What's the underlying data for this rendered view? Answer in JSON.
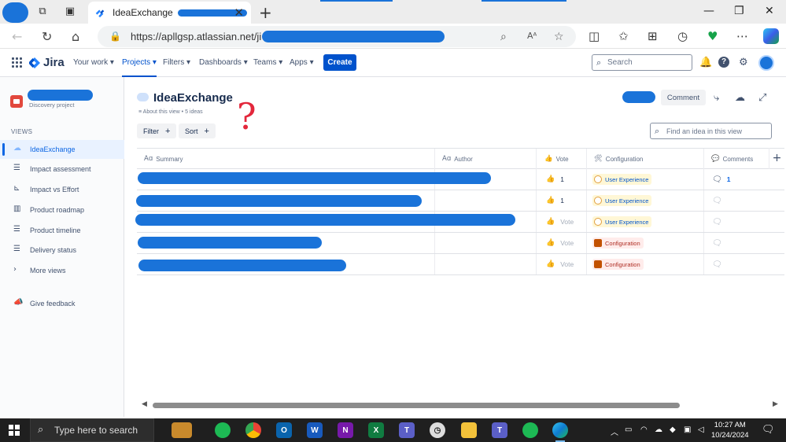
{
  "browser": {
    "tab_title": "IdeaExchange",
    "url": "https://apllgsp.atlassian.net/ji"
  },
  "jira": {
    "logo": "Jira",
    "nav": [
      "Your work",
      "Projects",
      "Filters",
      "Dashboards",
      "Teams",
      "Apps"
    ],
    "create_label": "Create",
    "search_placeholder": "Search"
  },
  "sidebar": {
    "project_type": "Discovery project",
    "views_heading": "VIEWS",
    "items": [
      {
        "label": "IdeaExchange",
        "icon": "cloud-icon"
      },
      {
        "label": "Impact assessment",
        "icon": "list-icon"
      },
      {
        "label": "Impact vs Effort",
        "icon": "matrix-icon"
      },
      {
        "label": "Product roadmap",
        "icon": "board-icon"
      },
      {
        "label": "Product timeline",
        "icon": "timeline-icon"
      },
      {
        "label": "Delivery status",
        "icon": "list-icon"
      },
      {
        "label": "More views",
        "icon": "chevron-right-icon"
      }
    ],
    "feedback": "Give feedback"
  },
  "main": {
    "title": "IdeaExchange",
    "about": "About this view • 5 ideas",
    "filter_label": "Filter",
    "sort_label": "Sort",
    "comment_label": "Comment",
    "find_placeholder": "Find an idea in this view",
    "annotation": "?"
  },
  "table": {
    "headers": {
      "summary": "Summary",
      "author": "Author",
      "vote": "Vote",
      "configuration": "Configuration",
      "comments": "Comments"
    },
    "vote_placeholder": "Vote",
    "rows": [
      {
        "vote": "1",
        "config": "User Experience",
        "config_kind": "ux",
        "comments": "1"
      },
      {
        "vote": "1",
        "config": "User Experience",
        "config_kind": "ux",
        "comments": ""
      },
      {
        "vote": "",
        "config": "User Experience",
        "config_kind": "ux",
        "comments": ""
      },
      {
        "vote": "",
        "config": "Configuration",
        "config_kind": "cfg",
        "comments": ""
      },
      {
        "vote": "",
        "config": "Configuration",
        "config_kind": "cfg",
        "comments": ""
      }
    ]
  },
  "taskbar": {
    "search_placeholder": "Type here to search",
    "time": "10:27 AM",
    "date": "10/24/2024"
  },
  "colors": {
    "accent": "#0052cc",
    "redaction": "#1a73d9",
    "annotation": "#e3273b"
  }
}
